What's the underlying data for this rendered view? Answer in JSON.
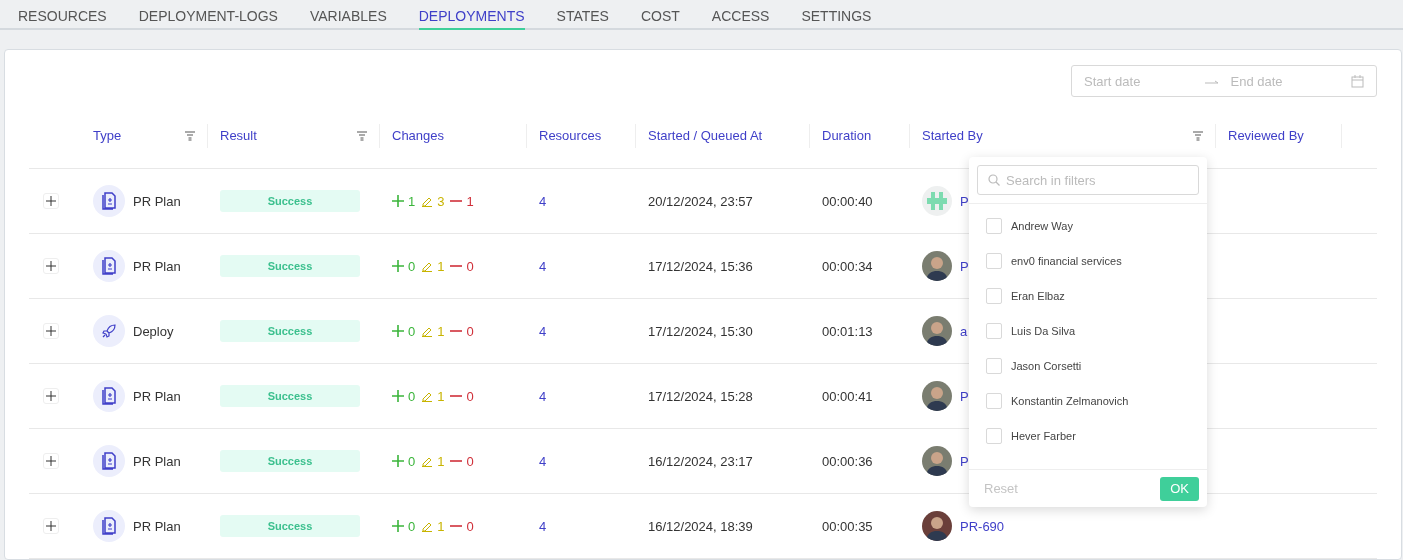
{
  "tabs": [
    {
      "label": "RESOURCES",
      "selected": false
    },
    {
      "label": "DEPLOYMENT-LOGS",
      "selected": false
    },
    {
      "label": "VARIABLES",
      "selected": false
    },
    {
      "label": "DEPLOYMENTS",
      "selected": true
    },
    {
      "label": "STATES",
      "selected": false
    },
    {
      "label": "COST",
      "selected": false
    },
    {
      "label": "ACCESS",
      "selected": false
    },
    {
      "label": "SETTINGS",
      "selected": false
    }
  ],
  "date_range": {
    "start_placeholder": "Start date",
    "end_placeholder": "End date"
  },
  "table": {
    "columns": [
      {
        "label": "Type",
        "filter": true
      },
      {
        "label": "Result",
        "filter": true
      },
      {
        "label": "Changes",
        "filter": false
      },
      {
        "label": "Resources",
        "filter": false
      },
      {
        "label": "Started / Queued At",
        "filter": false
      },
      {
        "label": "Duration",
        "filter": false
      },
      {
        "label": "Started By",
        "filter": true
      },
      {
        "label": "Reviewed By",
        "filter": false
      }
    ],
    "rows": [
      {
        "type": "PR Plan",
        "kind": "plan",
        "result": "Success",
        "added": "1",
        "modified": "3",
        "removed": "1",
        "resources": "4",
        "started_at": "20/12/2024, 23:57",
        "duration": "00:00:40",
        "avatar": {
          "kind": "identicon"
        },
        "started_by": "P"
      },
      {
        "type": "PR Plan",
        "kind": "plan",
        "result": "Success",
        "added": "0",
        "modified": "1",
        "removed": "0",
        "resources": "4",
        "started_at": "17/12/2024, 15:36",
        "duration": "00:00:34",
        "avatar": {
          "kind": "photo"
        },
        "started_by": "P"
      },
      {
        "type": "Deploy",
        "kind": "deploy",
        "result": "Success",
        "added": "0",
        "modified": "1",
        "removed": "0",
        "resources": "4",
        "started_at": "17/12/2024, 15:30",
        "duration": "00:01:13",
        "avatar": {
          "kind": "photo"
        },
        "started_by": "a"
      },
      {
        "type": "PR Plan",
        "kind": "plan",
        "result": "Success",
        "added": "0",
        "modified": "1",
        "removed": "0",
        "resources": "4",
        "started_at": "17/12/2024, 15:28",
        "duration": "00:00:41",
        "avatar": {
          "kind": "photo"
        },
        "started_by": "P"
      },
      {
        "type": "PR Plan",
        "kind": "plan",
        "result": "Success",
        "added": "0",
        "modified": "1",
        "removed": "0",
        "resources": "4",
        "started_at": "16/12/2024, 23:17",
        "duration": "00:00:36",
        "avatar": {
          "kind": "photo"
        },
        "started_by": "P"
      },
      {
        "type": "PR Plan",
        "kind": "plan",
        "result": "Success",
        "added": "0",
        "modified": "1",
        "removed": "0",
        "resources": "4",
        "started_at": "16/12/2024, 18:39",
        "duration": "00:00:35",
        "avatar": {
          "kind": "photo-dark"
        },
        "started_by": "PR-690"
      }
    ]
  },
  "filter_dropdown": {
    "search_placeholder": "Search in filters",
    "options": [
      {
        "label": "Andrew Way",
        "checked": false
      },
      {
        "label": "env0 financial services",
        "checked": false
      },
      {
        "label": "Eran Elbaz",
        "checked": false
      },
      {
        "label": "Luis Da Silva",
        "checked": false
      },
      {
        "label": "Jason Corsetti",
        "checked": false
      },
      {
        "label": "Konstantin Zelmanovich",
        "checked": false
      },
      {
        "label": "Hever Farber",
        "checked": false
      }
    ],
    "reset_label": "Reset",
    "ok_label": "OK"
  }
}
